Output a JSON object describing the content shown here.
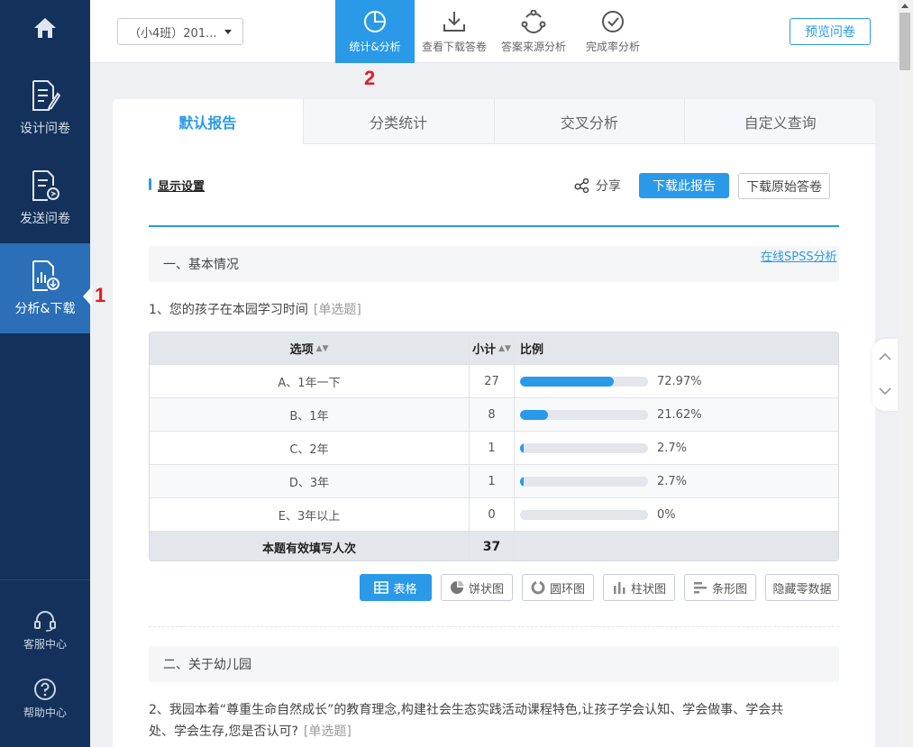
{
  "sidebar": {
    "home_icon": "home-icon",
    "items": [
      {
        "label": "设计问卷",
        "icon": "edit-document-icon"
      },
      {
        "label": "发送问卷",
        "icon": "send-document-icon"
      },
      {
        "label": "分析&下载",
        "icon": "analysis-download-icon",
        "active": true
      }
    ],
    "service": "客服中心",
    "help": "帮助中心"
  },
  "annotations": {
    "one": "1",
    "two": "2"
  },
  "topbar": {
    "survey_select": "（小4班）201...",
    "tabs": [
      {
        "label": "统计&分析",
        "icon": "pie-chart-icon",
        "active": true
      },
      {
        "label": "查看下载答卷",
        "icon": "download-icon"
      },
      {
        "label": "答案来源分析",
        "icon": "share-network-icon"
      },
      {
        "label": "完成率分析",
        "icon": "check-circle-icon"
      }
    ],
    "preview": "预览问卷"
  },
  "report_tabs": [
    "默认报告",
    "分类统计",
    "交叉分析",
    "自定义查询"
  ],
  "toolbar": {
    "display_settings": "显示设置",
    "share": "分享",
    "download_report": "下载此报告",
    "download_raw": "下载原始答卷"
  },
  "section1": {
    "title": "一、基本情况",
    "spss": "在线SPSS分析",
    "question": "1、您的孩子在本园学习时间",
    "qtype": "[单选题]",
    "headers": {
      "option": "选项",
      "count": "小计",
      "ratio": "比例",
      "sort_glyph": "▲▼"
    },
    "rows": [
      {
        "option": "A、1年一下",
        "count": "27",
        "pct": "72.97%",
        "fraction": 0.7297
      },
      {
        "option": "B、1年",
        "count": "8",
        "pct": "21.62%",
        "fraction": 0.2162
      },
      {
        "option": "C、2年",
        "count": "1",
        "pct": "2.7%",
        "fraction": 0.027
      },
      {
        "option": "D、3年",
        "count": "1",
        "pct": "2.7%",
        "fraction": 0.027
      },
      {
        "option": "E、3年以上",
        "count": "0",
        "pct": "0%",
        "fraction": 0
      }
    ],
    "footer": {
      "label": "本题有效填写人次",
      "total": "37"
    },
    "chart_buttons": [
      "表格",
      "饼状图",
      "圆环图",
      "柱状图",
      "条形图",
      "隐藏零数据"
    ]
  },
  "section2": {
    "title": "二、关于幼儿园",
    "question": "2、我园本着“尊重生命自然成长”的教育理念,构建社会生态实践活动课程特色,让孩子学会认知、学会做事、学会共处、学会生存,您是否认可?",
    "qtype": "[单选题]"
  },
  "colors": {
    "sidebar": "#13315a",
    "sidebar_active": "#2a6fb8",
    "accent": "#2a9ae8",
    "annotation": "#e01e1e"
  }
}
